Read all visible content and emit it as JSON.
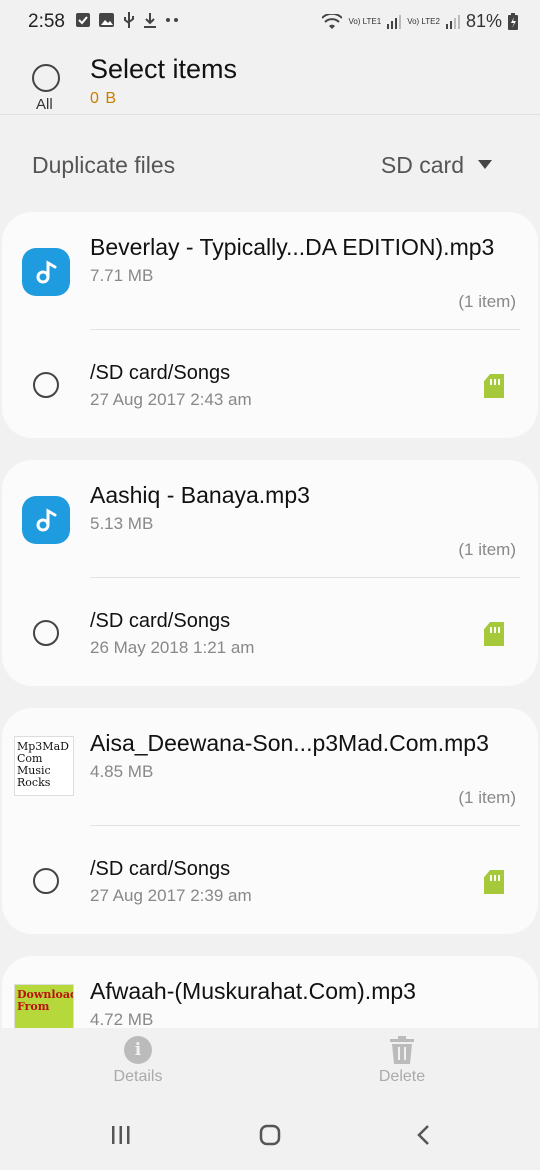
{
  "status": {
    "time": "2:58",
    "lte1": "Vo) LTE1",
    "lte2": "Vo) LTE2",
    "battery": "81%",
    "left_icons": [
      "check-box-icon",
      "image-icon",
      "usb-icon",
      "download-icon",
      "more-dots-icon"
    ]
  },
  "header": {
    "all_label": "All",
    "title": "Select items",
    "selected_size": "0 B"
  },
  "filter": {
    "title": "Duplicate files",
    "storage": "SD card"
  },
  "files": [
    {
      "name": "Beverlay - Typically...DA EDITION).mp3",
      "size": "7.71 MB",
      "count": "(1 item)",
      "path": "/SD card/Songs",
      "date": "27 Aug 2017 2:43 am",
      "icon": "music-note-icon"
    },
    {
      "name": "Aashiq - Banaya.mp3",
      "size": "5.13 MB",
      "count": "(1 item)",
      "path": "/SD card/Songs",
      "date": "26 May 2018 1:21 am",
      "icon": "music-note-icon"
    },
    {
      "name": "Aisa_Deewana-Son...p3Mad.Com.mp3",
      "size": "4.85 MB",
      "count": "(1 item)",
      "path": "/SD card/Songs",
      "date": "27 Aug 2017 2:39 am",
      "icon": "album-art-thumbnail",
      "thumb_text": "Mp3MaD Com Music Rocks"
    },
    {
      "name": "Afwaah-(Muskurahat.Com).mp3",
      "size": "4.72 MB",
      "icon": "album-art-thumbnail",
      "thumb_text": "Downloaded From"
    }
  ],
  "actions": {
    "details": "Details",
    "delete": "Delete"
  },
  "colors": {
    "accent_size": "#c77f00",
    "music_icon": "#1f9ce0",
    "sd_icon": "#a5c93a"
  }
}
